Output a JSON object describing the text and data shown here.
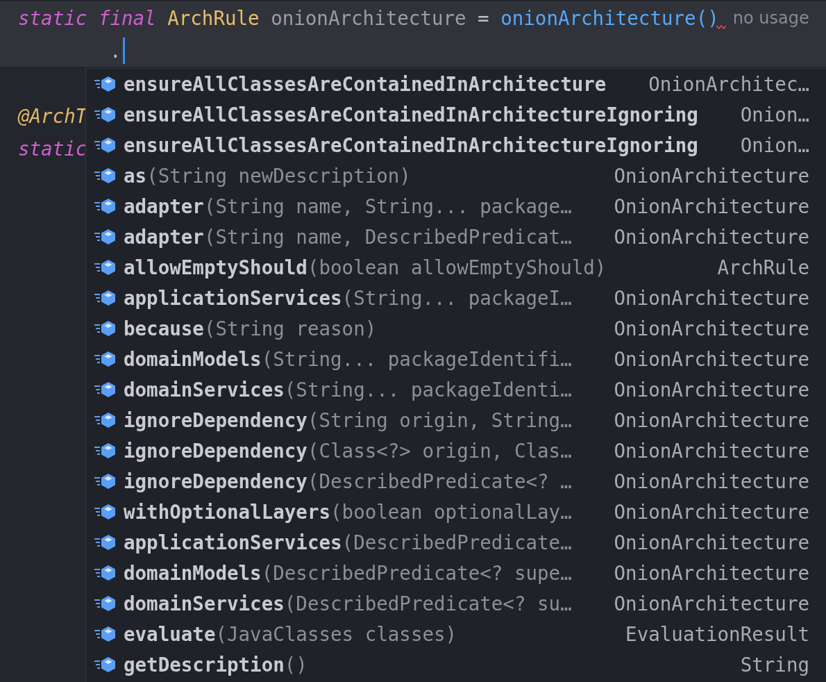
{
  "editor": {
    "lines": [
      {
        "kind": "code",
        "highlighted": true,
        "tokens": [
          {
            "kind": "keyword",
            "text": "static final"
          },
          {
            "kind": "type",
            "text": "ArchRule"
          },
          {
            "kind": "field",
            "text": "onionArchitecture"
          },
          {
            "kind": "plain",
            "text": "="
          },
          {
            "kind": "call",
            "text": "onionArchitecture()"
          }
        ],
        "error": true,
        "hint": "no usage"
      },
      {
        "kind": "continuation",
        "highlighted": true,
        "tokens": [
          {
            "kind": "plain",
            "text": "."
          }
        ],
        "caret": true
      },
      {
        "kind": "blank",
        "highlighted": false
      },
      {
        "kind": "code",
        "highlighted": false,
        "tokens": [
          {
            "kind": "annotation",
            "text": "@ArchT"
          }
        ]
      },
      {
        "kind": "code",
        "highlighted": false,
        "tokens": [
          {
            "kind": "keyword",
            "text": "static"
          }
        ]
      }
    ]
  },
  "completion_popup": {
    "items": [
      {
        "name": "ensureAllClassesAreContainedInArchitecture",
        "type": "OnionArchitec…"
      },
      {
        "name": "ensureAllClassesAreContainedInArchitectureIgnoring",
        "type": "Onion…"
      },
      {
        "name": "ensureAllClassesAreContainedInArchitectureIgnoring",
        "type": "Onion…"
      },
      {
        "name": "as",
        "params": "(String newDescription)",
        "type": "OnionArchitecture"
      },
      {
        "name": "adapter",
        "params": "(String name, String... package…",
        "type": "OnionArchitecture"
      },
      {
        "name": "adapter",
        "params": "(String name, DescribedPredicat…",
        "type": "OnionArchitecture"
      },
      {
        "name": "allowEmptyShould",
        "params": "(boolean allowEmptyShould)",
        "type": "ArchRule"
      },
      {
        "name": "applicationServices",
        "params": "(String... packageI…",
        "type": "OnionArchitecture"
      },
      {
        "name": "because",
        "params": "(String reason)",
        "type": "OnionArchitecture"
      },
      {
        "name": "domainModels",
        "params": "(String... packageIdentifi…",
        "type": "OnionArchitecture"
      },
      {
        "name": "domainServices",
        "params": "(String... packageIdenti…",
        "type": "OnionArchitecture"
      },
      {
        "name": "ignoreDependency",
        "params": "(String origin, String…",
        "type": "OnionArchitecture"
      },
      {
        "name": "ignoreDependency",
        "params": "(Class<?> origin, Clas…",
        "type": "OnionArchitecture"
      },
      {
        "name": "ignoreDependency",
        "params": "(DescribedPredicate<? …",
        "type": "OnionArchitecture"
      },
      {
        "name": "withOptionalLayers",
        "params": "(boolean optionalLay…",
        "type": "OnionArchitecture"
      },
      {
        "name": "applicationServices",
        "params": "(DescribedPredicate…",
        "type": "OnionArchitecture"
      },
      {
        "name": "domainModels",
        "params": "(DescribedPredicate<? supe…",
        "type": "OnionArchitecture"
      },
      {
        "name": "domainServices",
        "params": "(DescribedPredicate<? su…",
        "type": "OnionArchitecture"
      },
      {
        "name": "evaluate",
        "params": "(JavaClasses classes)",
        "type": "EvaluationResult"
      },
      {
        "name": "getDescription",
        "params": "()",
        "type": "String"
      }
    ]
  }
}
